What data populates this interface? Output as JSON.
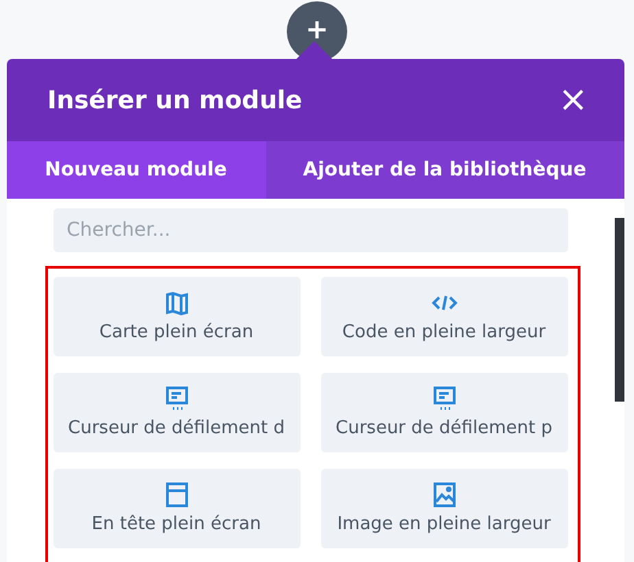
{
  "add_button": {
    "symbol": "+"
  },
  "dialog": {
    "title": "Insérer un module",
    "close": "×"
  },
  "tabs": [
    {
      "label": "Nouveau module",
      "selected": true
    },
    {
      "label": "Ajouter de la bibliothèque",
      "selected": false
    }
  ],
  "search": {
    "placeholder": "Chercher..."
  },
  "modules": [
    {
      "label": "Carte plein écran",
      "kind": "map"
    },
    {
      "label": "Code en pleine largeur",
      "kind": "code"
    },
    {
      "label": "Curseur de défilement d",
      "kind": "slider"
    },
    {
      "label": "Curseur de défilement p",
      "kind": "slider"
    },
    {
      "label": "En tête plein écran",
      "kind": "header"
    },
    {
      "label": "Image en pleine largeur",
      "kind": "image"
    }
  ]
}
